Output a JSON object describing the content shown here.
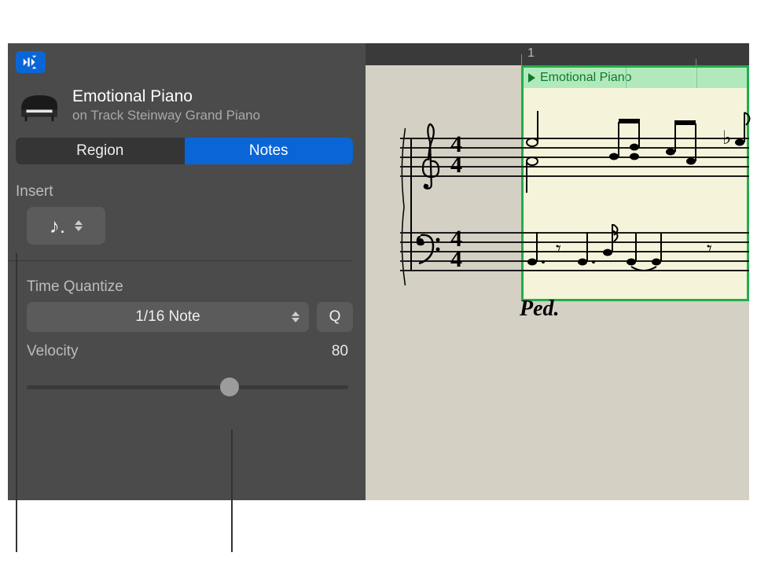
{
  "header": {
    "region_name": "Emotional Piano",
    "track_line": "on Track Steinway Grand Piano"
  },
  "tabs": {
    "region": "Region",
    "notes": "Notes",
    "active": "notes"
  },
  "insert": {
    "label": "Insert",
    "note_value_icon": "eighth-note"
  },
  "quantize": {
    "label": "Time Quantize",
    "value": "1/16 Note",
    "button": "Q"
  },
  "velocity": {
    "label": "Velocity",
    "value": "80",
    "min": 0,
    "max": 127,
    "slider_percent": 63
  },
  "ruler": {
    "bar_number": "1"
  },
  "score_region": {
    "name": "Emotional Piano",
    "time_signature": "4/4",
    "pedal_mark": "Ped."
  }
}
